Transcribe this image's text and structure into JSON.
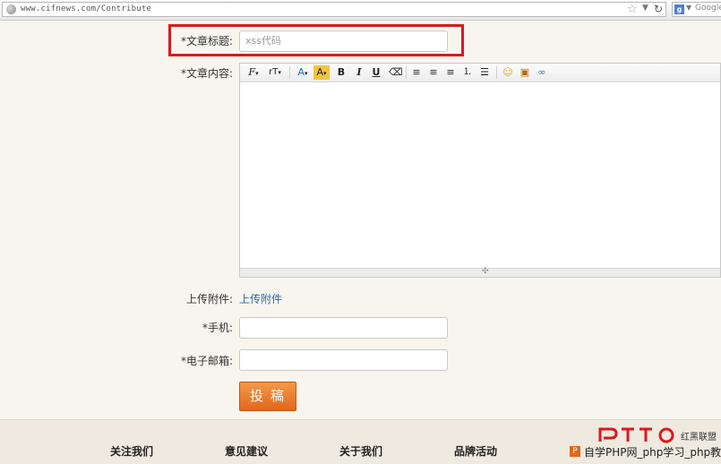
{
  "browser": {
    "url": "www.cifnews.com/Contribute",
    "search_engine": "Google"
  },
  "form": {
    "title_label": "*文章标题:",
    "title_value": "xss代码",
    "content_label": "*文章内容:",
    "attach_label": "上传附件:",
    "attach_link": "上传附件",
    "phone_label": "*手机:",
    "email_label": "*电子邮箱:",
    "submit_label": "投稿"
  },
  "toolbar": {
    "font_family": "F",
    "font_size": "rT",
    "font_color": "A",
    "highlight": "A",
    "bold": "B",
    "italic": "I",
    "underline": "U"
  },
  "footer": {
    "links": [
      "关注我们",
      "意见建议",
      "关于我们",
      "品牌活动"
    ],
    "watermark_brand": "红黑联盟",
    "watermark_text": "自学PHP网_php学习_php教程"
  },
  "colors": {
    "highlight_border": "#d9181f",
    "submit_button": "#e2661a",
    "link": "#2a68b0"
  }
}
